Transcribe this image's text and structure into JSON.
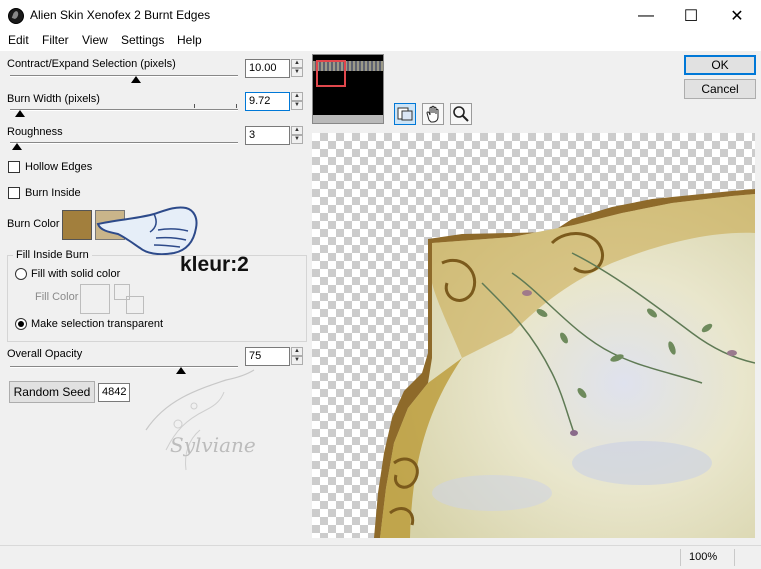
{
  "window": {
    "title": "Alien Skin Xenofex 2 Burnt Edges",
    "minimize": "—",
    "maximize": "☐",
    "close": "✕"
  },
  "menu": {
    "items": [
      "Edit",
      "Filter",
      "View",
      "Settings",
      "Help"
    ]
  },
  "params": {
    "contract_label": "Contract/Expand Selection (pixels)",
    "contract_value": "10.00",
    "burn_width_label": "Burn Width (pixels)",
    "burn_width_value": "9.72",
    "roughness_label": "Roughness",
    "roughness_value": "3",
    "hollow_edges_label": "Hollow Edges",
    "burn_inside_label": "Burn Inside",
    "burn_color_label": "Burn Color",
    "burn_color": "#a27f3d",
    "fill_inside_burn_label": "Fill Inside Burn",
    "fill_solid_label": "Fill with solid color",
    "fill_color_label": "Fill Color",
    "make_transparent_label": "Make selection transparent",
    "overall_opacity_label": "Overall Opacity",
    "overall_opacity_value": "75",
    "random_seed_label": "Random Seed",
    "random_seed_value": "4842"
  },
  "annotation": {
    "text": "kleur:2",
    "watermark": "Sylviane"
  },
  "buttons": {
    "ok": "OK",
    "cancel": "Cancel"
  },
  "status": {
    "zoom": "100%"
  },
  "colors": {
    "accent": "#0078d7",
    "burn": "#a27f3d",
    "image_bg": "#ece8c4",
    "gold": "#b8952e"
  }
}
